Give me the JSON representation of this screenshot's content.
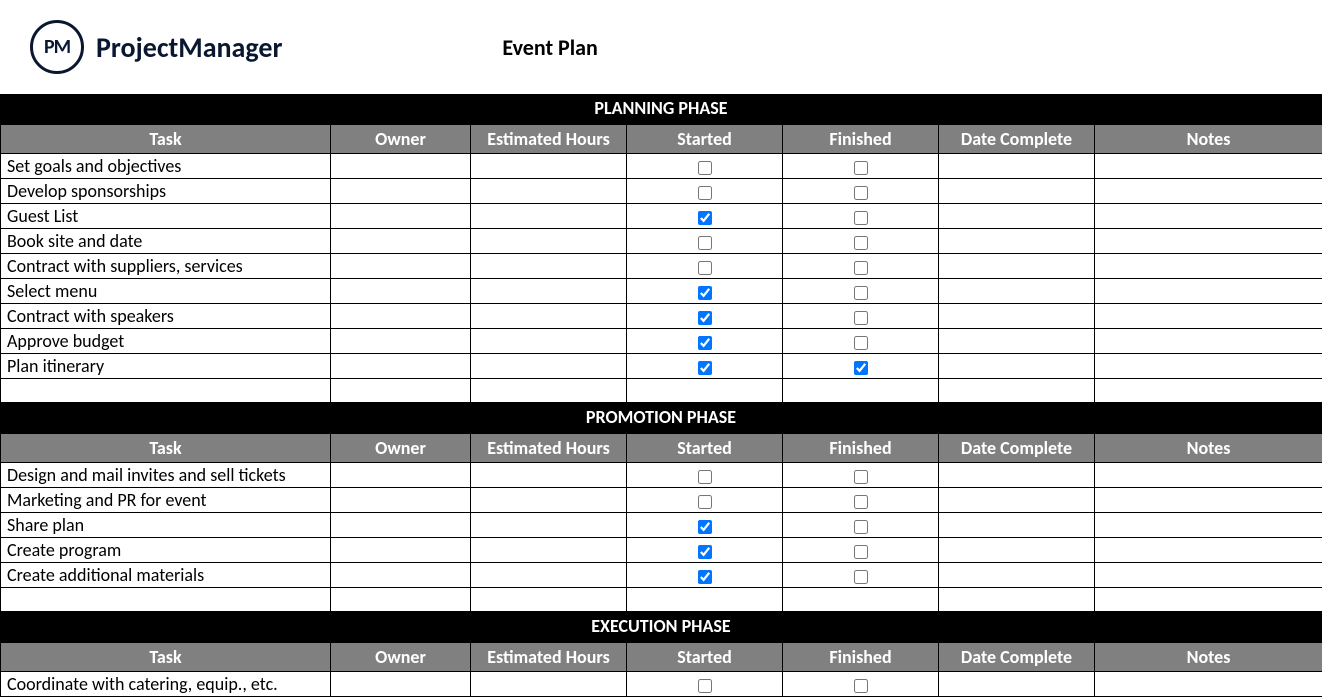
{
  "brand": {
    "abbr": "PM",
    "name": "ProjectManager"
  },
  "title": "Event Plan",
  "columns": {
    "task": "Task",
    "owner": "Owner",
    "hours": "Estimated Hours",
    "started": "Started",
    "finished": "Finished",
    "date": "Date Complete",
    "notes": "Notes"
  },
  "phases": [
    {
      "name": "PLANNING PHASE",
      "rows": [
        {
          "task": "Set goals and objectives",
          "owner": "",
          "hours": "",
          "started": false,
          "finished": false,
          "date": "",
          "notes": ""
        },
        {
          "task": "Develop sponsorships",
          "owner": "",
          "hours": "",
          "started": false,
          "finished": false,
          "date": "",
          "notes": ""
        },
        {
          "task": "Guest List",
          "owner": "",
          "hours": "",
          "started": true,
          "finished": false,
          "date": "",
          "notes": ""
        },
        {
          "task": "Book site and date",
          "owner": "",
          "hours": "",
          "started": false,
          "finished": false,
          "date": "",
          "notes": ""
        },
        {
          "task": "Contract with suppliers, services",
          "owner": "",
          "hours": "",
          "started": false,
          "finished": false,
          "date": "",
          "notes": ""
        },
        {
          "task": "Select menu",
          "owner": "",
          "hours": "",
          "started": true,
          "finished": false,
          "date": "",
          "notes": ""
        },
        {
          "task": "Contract with speakers",
          "owner": "",
          "hours": "",
          "started": true,
          "finished": false,
          "date": "",
          "notes": ""
        },
        {
          "task": "Approve budget",
          "owner": "",
          "hours": "",
          "started": true,
          "finished": false,
          "date": "",
          "notes": ""
        },
        {
          "task": "Plan itinerary",
          "owner": "",
          "hours": "",
          "started": true,
          "finished": true,
          "date": "",
          "notes": ""
        },
        {
          "task": "",
          "owner": "",
          "hours": "",
          "started": null,
          "finished": null,
          "date": "",
          "notes": ""
        }
      ]
    },
    {
      "name": "PROMOTION PHASE",
      "rows": [
        {
          "task": "Design and mail invites and sell tickets",
          "owner": "",
          "hours": "",
          "started": false,
          "finished": false,
          "date": "",
          "notes": ""
        },
        {
          "task": "Marketing and PR for event",
          "owner": "",
          "hours": "",
          "started": false,
          "finished": false,
          "date": "",
          "notes": ""
        },
        {
          "task": "Share plan",
          "owner": "",
          "hours": "",
          "started": true,
          "finished": false,
          "date": "",
          "notes": ""
        },
        {
          "task": "Create program",
          "owner": "",
          "hours": "",
          "started": true,
          "finished": false,
          "date": "",
          "notes": ""
        },
        {
          "task": "Create additional materials",
          "owner": "",
          "hours": "",
          "started": true,
          "finished": false,
          "date": "",
          "notes": ""
        },
        {
          "task": "",
          "owner": "",
          "hours": "",
          "started": null,
          "finished": null,
          "date": "",
          "notes": ""
        }
      ]
    },
    {
      "name": "EXECUTION PHASE",
      "rows": [
        {
          "task": "Coordinate with catering, equip., etc.",
          "owner": "",
          "hours": "",
          "started": false,
          "finished": false,
          "date": "",
          "notes": ""
        }
      ]
    }
  ]
}
